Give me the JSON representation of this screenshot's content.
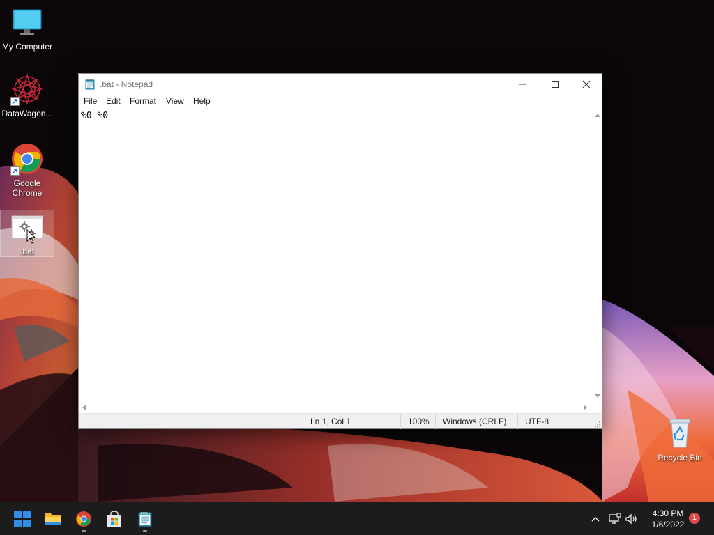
{
  "desktop": {
    "icons": [
      {
        "label": "My Computer",
        "icon": "monitor-icon"
      },
      {
        "label": "DataWagon...",
        "icon": "datawagon-icon"
      },
      {
        "label": "Google Chrome",
        "icon": "chrome-icon"
      },
      {
        "label": ".bat",
        "icon": "batch-file-icon"
      },
      {
        "label": "Recycle Bin",
        "icon": "recycle-bin-icon"
      }
    ]
  },
  "window": {
    "title": ".bat - Notepad",
    "menu": [
      "File",
      "Edit",
      "Format",
      "View",
      "Help"
    ],
    "content": "%0 %0",
    "status": {
      "position": "Ln 1, Col 1",
      "zoom": "100%",
      "line_endings": "Windows (CRLF)",
      "encoding": "UTF-8"
    }
  },
  "taskbar": {
    "apps": [
      "start-icon",
      "file-explorer-icon",
      "chrome-icon",
      "store-icon",
      "notepad-icon"
    ],
    "tray": [
      "chevron-up-icon",
      "network-icon",
      "volume-icon"
    ],
    "time": "4:30 PM",
    "date": "1/6/2022",
    "notifications": "1"
  },
  "colors": {
    "taskbar": "#1c1c1c",
    "start_blue": "#2f8fe6",
    "notification": "#e34b4b"
  }
}
